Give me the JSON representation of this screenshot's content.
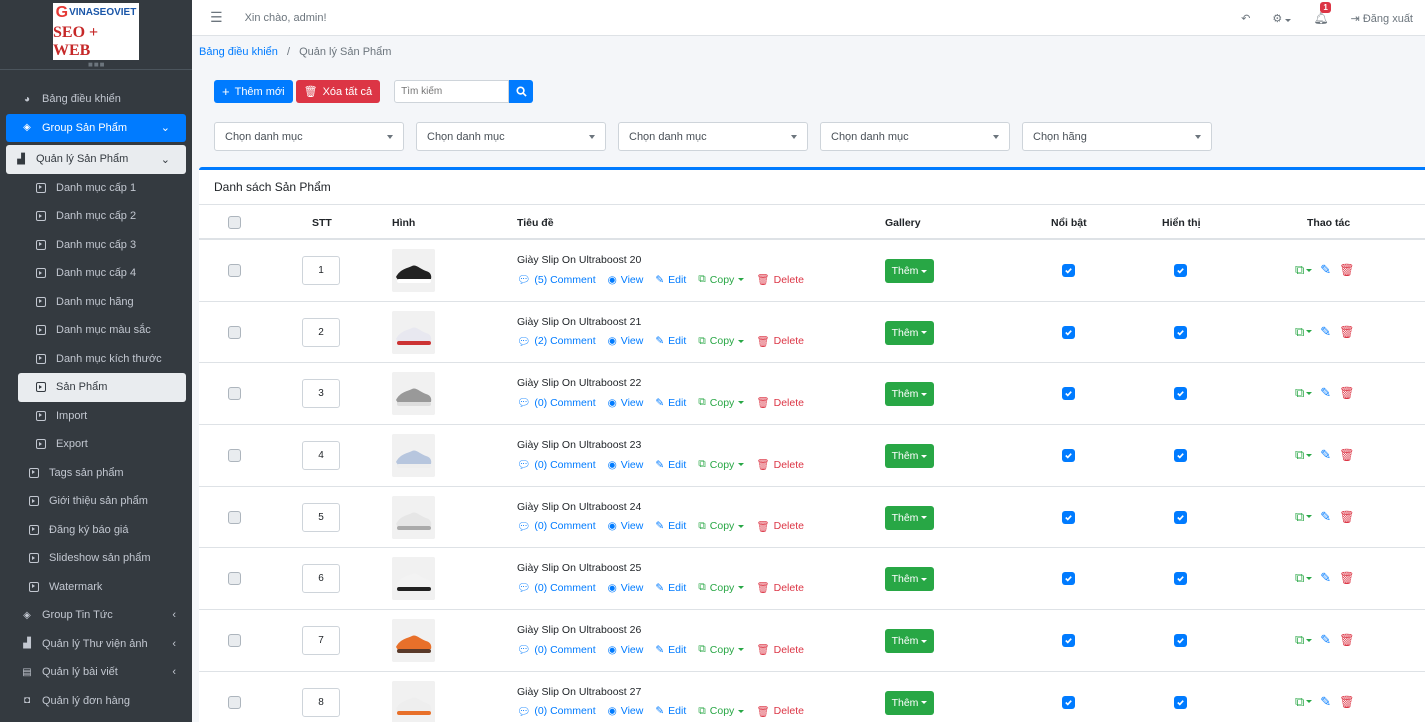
{
  "brand": {
    "logo_line1": "VINASEOVIET",
    "logo_line2": "SEO + WEB"
  },
  "topbar": {
    "greeting": "Xin chào, admin!",
    "notification_count": "1",
    "logout_label": "Đăng xuất"
  },
  "sidebar": {
    "items": [
      {
        "label": "Bảng điều khiển"
      },
      {
        "label": "Group Sản Phẩm"
      },
      {
        "label": "Quản lý Sản Phẩm"
      },
      {
        "label": "Danh mục cấp 1"
      },
      {
        "label": "Danh mục cấp 2"
      },
      {
        "label": "Danh mục cấp 3"
      },
      {
        "label": "Danh mục cấp 4"
      },
      {
        "label": "Danh mục hãng"
      },
      {
        "label": "Danh mục màu sắc"
      },
      {
        "label": "Danh mục kích thước"
      },
      {
        "label": "Sản Phẩm"
      },
      {
        "label": "Import"
      },
      {
        "label": "Export"
      },
      {
        "label": "Tags sản phẩm"
      },
      {
        "label": "Giới thiệu sản phẩm"
      },
      {
        "label": "Đăng ký báo giá"
      },
      {
        "label": "Slideshow sản phẩm"
      },
      {
        "label": "Watermark"
      },
      {
        "label": "Group Tin Tức"
      },
      {
        "label": "Quản lý Thư viện ảnh"
      },
      {
        "label": "Quản lý bài viết"
      },
      {
        "label": "Quản lý đơn hàng"
      }
    ]
  },
  "breadcrumb": {
    "home": "Bảng điều khiển",
    "separator": "/",
    "current": "Quản lý Sản Phẩm"
  },
  "toolbar": {
    "add_label": "Thêm mới",
    "delete_all_label": "Xóa tất cả",
    "search_placeholder": "Tìm kiếm"
  },
  "filters": {
    "category1": "Chọn danh mục",
    "category2": "Chọn danh mục",
    "category3": "Chọn danh mục",
    "category4": "Chọn danh mục",
    "brand": "Chọn hãng"
  },
  "table": {
    "title": "Danh sách Sản Phẩm",
    "headers": {
      "stt": "STT",
      "image": "Hình",
      "title": "Tiêu đề",
      "gallery": "Gallery",
      "featured": "Nổi bật",
      "visible": "Hiển thị",
      "actions": "Thao tác"
    },
    "labels": {
      "view": "View",
      "edit": "Edit",
      "copy": "Copy",
      "delete": "Delete",
      "gallery_btn": "Thêm"
    },
    "rows": [
      {
        "stt": "1",
        "title": "Giày Slip On Ultraboost 20",
        "comments": "(5) Comment"
      },
      {
        "stt": "2",
        "title": "Giày Slip On Ultraboost 21",
        "comments": "(2) Comment"
      },
      {
        "stt": "3",
        "title": "Giày Slip On Ultraboost 22",
        "comments": "(0) Comment"
      },
      {
        "stt": "4",
        "title": "Giày Slip On Ultraboost 23",
        "comments": "(0) Comment"
      },
      {
        "stt": "5",
        "title": "Giày Slip On Ultraboost 24",
        "comments": "(0) Comment"
      },
      {
        "stt": "6",
        "title": "Giày Slip On Ultraboost 25",
        "comments": "(0) Comment"
      },
      {
        "stt": "7",
        "title": "Giày Slip On Ultraboost 26",
        "comments": "(0) Comment"
      },
      {
        "stt": "8",
        "title": "Giày Slip On Ultraboost 27",
        "comments": "(0) Comment"
      }
    ]
  },
  "colors": {
    "primary": "#007bff",
    "danger": "#dc3545",
    "success": "#28a745",
    "sidebar": "#343a40"
  }
}
